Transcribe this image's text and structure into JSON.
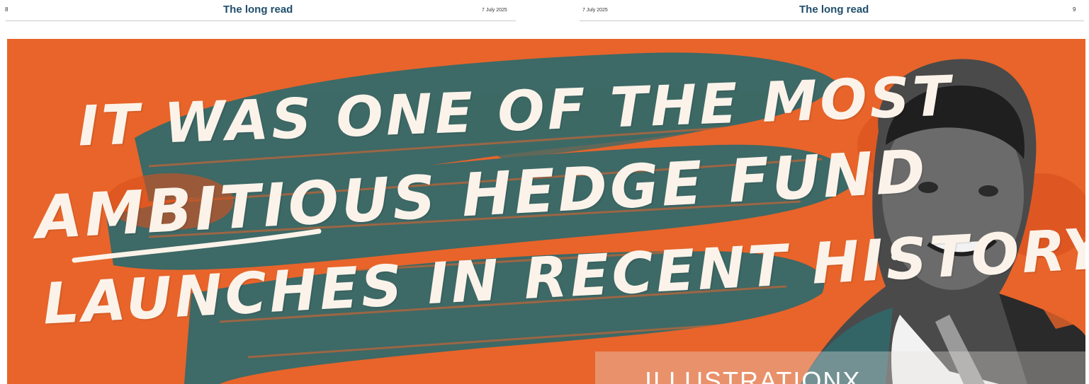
{
  "header": {
    "left_page_number": "8",
    "left_section": "The long read",
    "left_date": "7 July 2025",
    "right_date": "7 July 2025",
    "right_section": "The long read",
    "right_page_number": "9"
  },
  "illustration": {
    "headline_lines": [
      "It was one of the most",
      "ambitious hedge fund",
      "launches in recent history"
    ],
    "credit": "ILLUSTRATIONX",
    "colors": {
      "background": "#e8642a",
      "brush": "#2f6a6c",
      "lettering": "#fbf3ea"
    }
  }
}
